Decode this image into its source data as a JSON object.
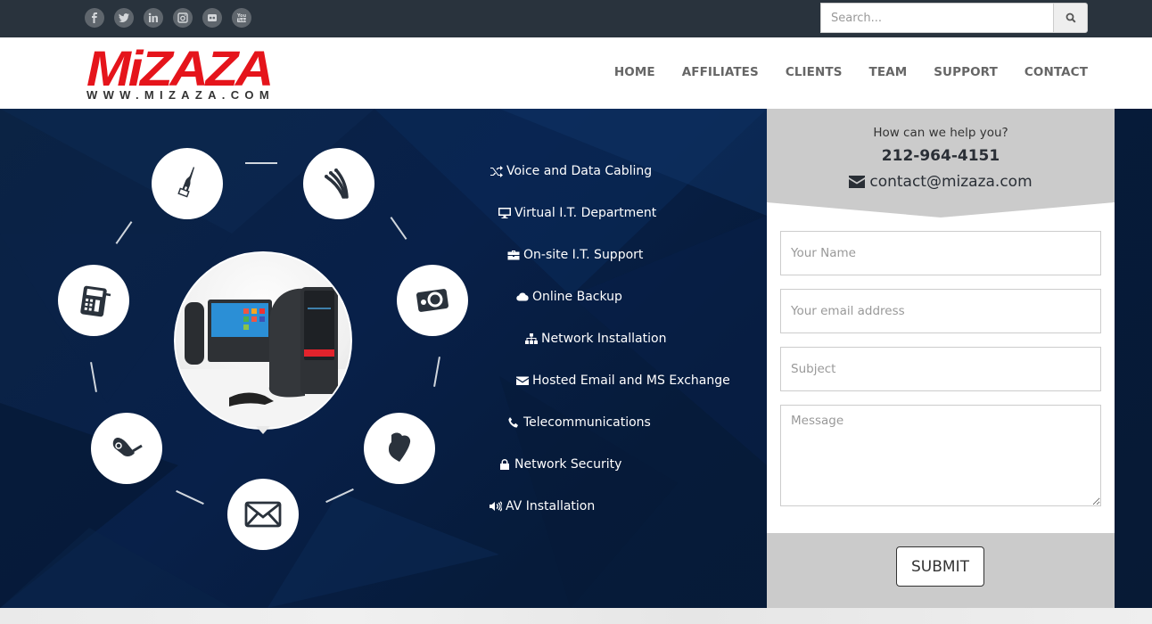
{
  "topbar": {
    "social": [
      {
        "name": "facebook",
        "glyph": "f"
      },
      {
        "name": "twitter",
        "glyph": "t"
      },
      {
        "name": "linkedin",
        "glyph": "in"
      },
      {
        "name": "instagram",
        "glyph": "ig"
      },
      {
        "name": "flickr",
        "glyph": "••"
      },
      {
        "name": "youtube",
        "glyph": "yt"
      }
    ],
    "search": {
      "placeholder": "Search...",
      "icon": "search-icon"
    }
  },
  "header": {
    "logo_main": "MiZAZA",
    "logo_sub": "WWW.MIZAZA.COM",
    "nav": [
      "HOME",
      "AFFILIATES",
      "CLIENTS",
      "TEAM",
      "SUPPORT",
      "CONTACT"
    ]
  },
  "hero": {
    "orbit_icons": [
      "ethernet-cable-icon",
      "av-cable-icon",
      "camera-icon",
      "cloud-icon",
      "envelope-icon",
      "security-camera-icon",
      "desk-phone-icon"
    ],
    "center_image": "ip-desk-phones-photo",
    "services": [
      {
        "label": "Voice and Data Cabling",
        "icon": "random-icon"
      },
      {
        "label": "Virtual I.T. Department",
        "icon": "desktop-icon"
      },
      {
        "label": "On-site I.T. Support",
        "icon": "briefcase-icon"
      },
      {
        "label": "Online Backup",
        "icon": "cloud-icon"
      },
      {
        "label": "Network Installation",
        "icon": "sitemap-icon"
      },
      {
        "label": "Hosted Email and MS Exchange",
        "icon": "envelope-icon"
      },
      {
        "label": "Telecommunications",
        "icon": "phone-icon"
      },
      {
        "label": "Network Security",
        "icon": "lock-icon"
      },
      {
        "label": "AV Installation",
        "icon": "volume-icon"
      }
    ]
  },
  "contact": {
    "help_text": "How can we help you?",
    "phone": "212-964-4151",
    "email": "contact@mizaza.com",
    "fields": {
      "name_placeholder": "Your Name",
      "email_placeholder": "Your email address",
      "subject_placeholder": "Subject",
      "message_placeholder": "Message"
    },
    "submit_label": "SUBMIT"
  },
  "colors": {
    "topbar": "#29333d",
    "brand_red": "#e5141b",
    "hero_navy": "#082049",
    "panel_gray": "#cbcbcb"
  }
}
